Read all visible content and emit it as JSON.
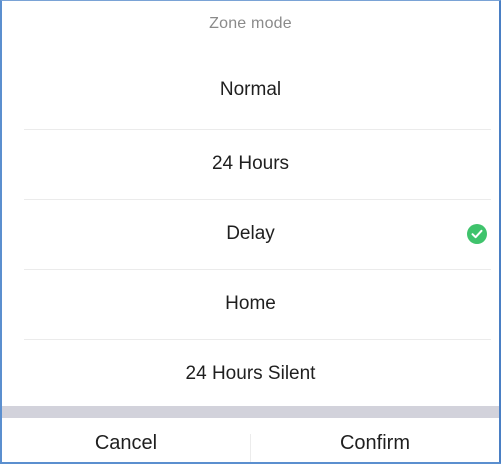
{
  "dialog": {
    "title": "Zone mode",
    "options": [
      {
        "label": "Normal",
        "selected": false
      },
      {
        "label": "24 Hours",
        "selected": false
      },
      {
        "label": "Delay",
        "selected": true
      },
      {
        "label": "Home",
        "selected": false
      },
      {
        "label": "24 Hours Silent",
        "selected": false
      }
    ],
    "selected_indicator_icon": "check-circle-icon",
    "colors": {
      "check": "#3fc36c",
      "title_text": "#8a8a8a",
      "band": "#d2d2db"
    },
    "actions": {
      "cancel_label": "Cancel",
      "confirm_label": "Confirm"
    }
  }
}
